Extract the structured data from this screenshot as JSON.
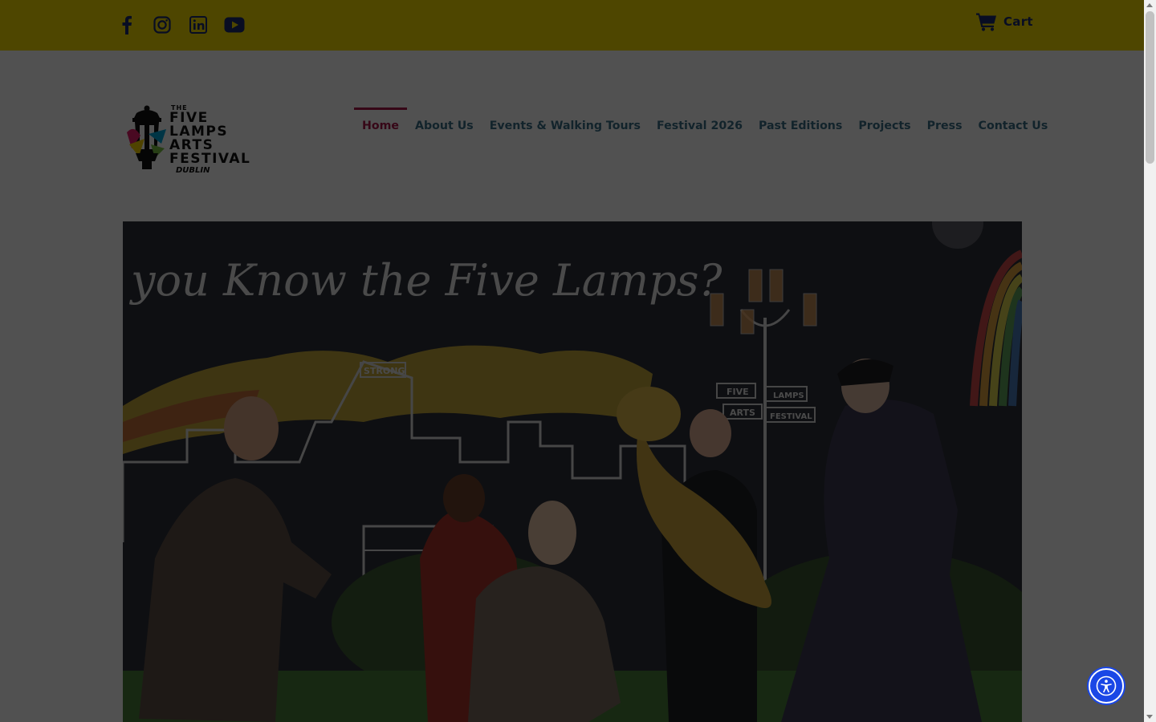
{
  "topbar": {
    "background": "#f2d900",
    "social_icons": [
      "facebook-icon",
      "instagram-icon",
      "linkedin-icon",
      "youtube-icon"
    ],
    "cart_label": "Cart"
  },
  "logo": {
    "the": "THE",
    "line1": "FIVE",
    "line2": "LAMPS",
    "line3": "ARTS",
    "line4": "FESTIVAL",
    "dublin": "DUBLIN"
  },
  "nav": {
    "items": [
      {
        "label": "Home",
        "active": true
      },
      {
        "label": "About Us"
      },
      {
        "label": "Events & Walking Tours"
      },
      {
        "label": "Festival 2026"
      },
      {
        "label": "Past Editions"
      },
      {
        "label": "Projects"
      },
      {
        "label": "Press"
      },
      {
        "label": "Contact Us"
      }
    ],
    "active_color": "#a8174a",
    "link_color": "#3a6e86"
  },
  "hero": {
    "mural_text": "you Know the Five Lamps?",
    "sign_five": "FIVE",
    "sign_lamps": "LAMPS",
    "sign_arts": "ARTS",
    "sign_festival": "FESTIVAL",
    "building_sign": "STRONG"
  },
  "accessibility": {
    "icon": "accessibility-icon",
    "color": "#1a47e6"
  }
}
